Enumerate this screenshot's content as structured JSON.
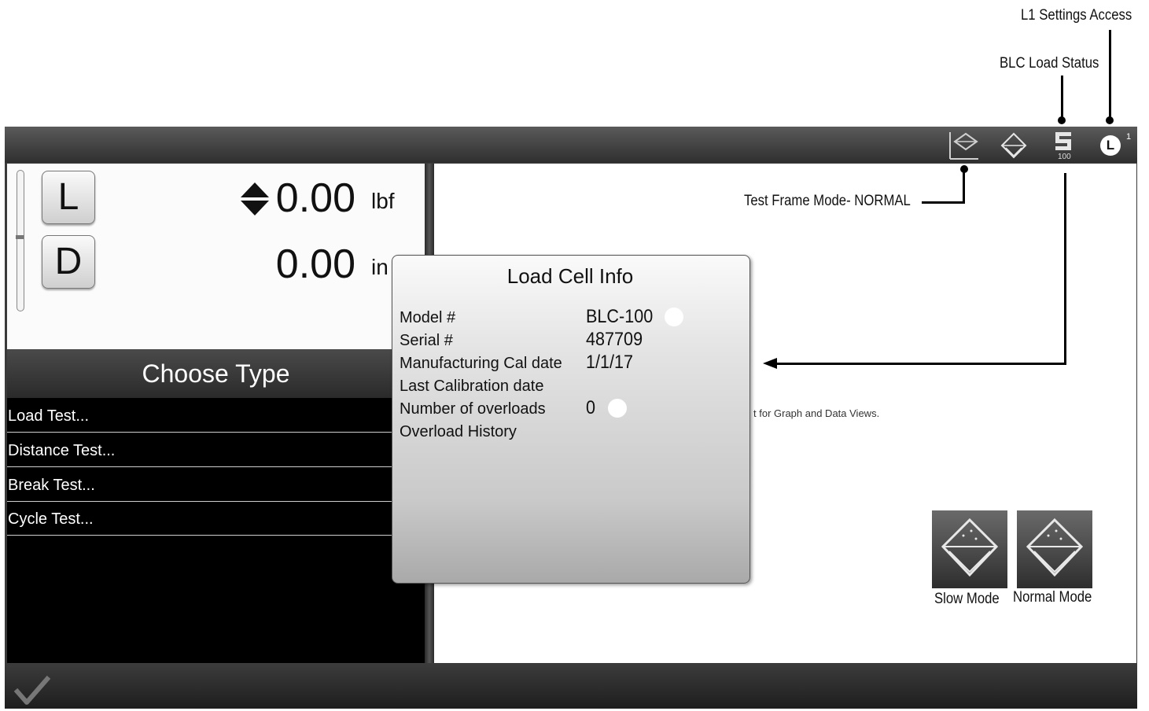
{
  "annotations": {
    "settings_access": "L1 Settings Access",
    "blc_load_status": "BLC Load Status",
    "test_frame_mode": "Test Frame Mode- NORMAL"
  },
  "topbar": {
    "status_icon_value": "100",
    "settings_icon_label": "L",
    "settings_icon_superscript": "1"
  },
  "readout": {
    "load_button": "L",
    "distance_button": "D",
    "load_value": "0.00",
    "load_unit": "lbf",
    "distance_value": "0.00",
    "distance_unit": "in"
  },
  "choose_type": {
    "title": "Choose Type",
    "items": [
      "Load Test...",
      "Distance Test...",
      "Break Test...",
      "Cycle Test..."
    ]
  },
  "main": {
    "hint_text": "t for Graph and Data Views.",
    "slow_mode_label": "Slow Mode",
    "normal_mode_label": "Normal Mode"
  },
  "popup": {
    "title": "Load Cell Info",
    "rows": [
      {
        "label": "Model #",
        "value": "BLC-100"
      },
      {
        "label": "Serial #",
        "value": "487709"
      },
      {
        "label": "Manufacturing Cal date",
        "value": "1/1/17"
      },
      {
        "label": "Last Calibration date",
        "value": ""
      },
      {
        "label": "Number of overloads",
        "value": "0"
      },
      {
        "label": "Overload History",
        "value": ""
      }
    ]
  }
}
